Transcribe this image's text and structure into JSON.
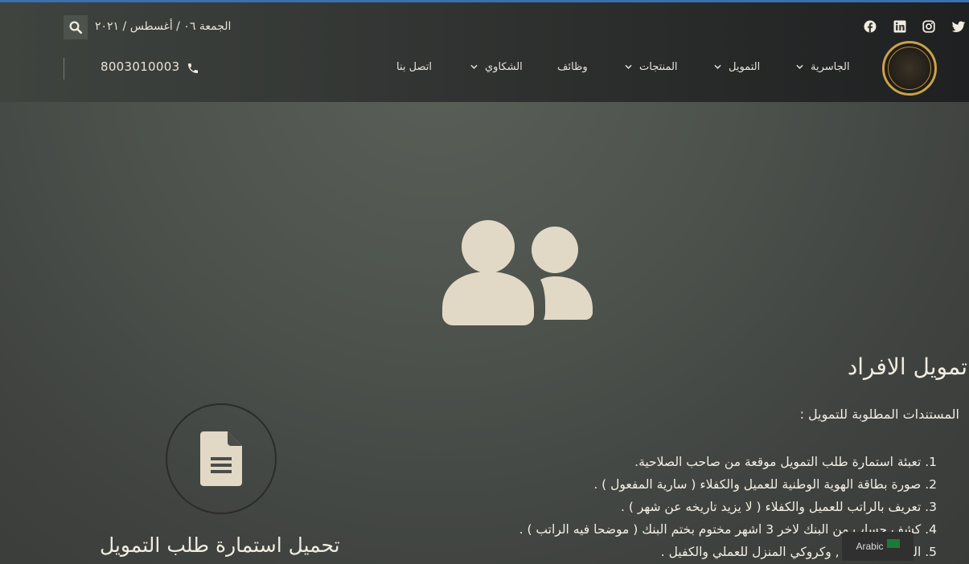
{
  "header": {
    "date": "الجمعة ٠٦ / أغسطس / ٢٠٢١",
    "phone": "8003010003",
    "nav": [
      {
        "label": "الجاسرية",
        "has_dropdown": true
      },
      {
        "label": "التمويل",
        "has_dropdown": true
      },
      {
        "label": "المنتجات",
        "has_dropdown": true
      },
      {
        "label": "وظائف",
        "has_dropdown": false
      },
      {
        "label": "الشكاوي",
        "has_dropdown": true
      },
      {
        "label": "اتصل بنا",
        "has_dropdown": false
      }
    ],
    "social_icons": [
      "twitter-icon",
      "instagram-icon",
      "linkedin-icon",
      "facebook-icon"
    ]
  },
  "main": {
    "title": "تمويل الافراد",
    "subheading": "المستندات المطلوبة للتمويل :",
    "requirements": [
      "1. تعبئة استمارة طلب التمويل موقعة من صاحب الصلاحية.",
      "2. صورة بطاقة الهوية الوطنية للعميل والكفلاء ( سارية المفعول ) .",
      "3. تعريف بالراتب للعميل والكفلاء ( لا يزيد تاريخه عن شهر ) .",
      "4. كشف حساب من البنك لاخر 3 اشهر مختوم بختم البنك ( موضحا فيه الراتب ) .",
      "5. العنوان الوطني , وكروكي المنزل للعملي والكفيل ."
    ],
    "download_label": "تحميل استمارة طلب التمويل"
  },
  "language": {
    "label": "Arabic"
  },
  "colors": {
    "accent": "#e2d8c6",
    "logo_gold": "#c9a24a",
    "header_dark": "#1f2021"
  }
}
